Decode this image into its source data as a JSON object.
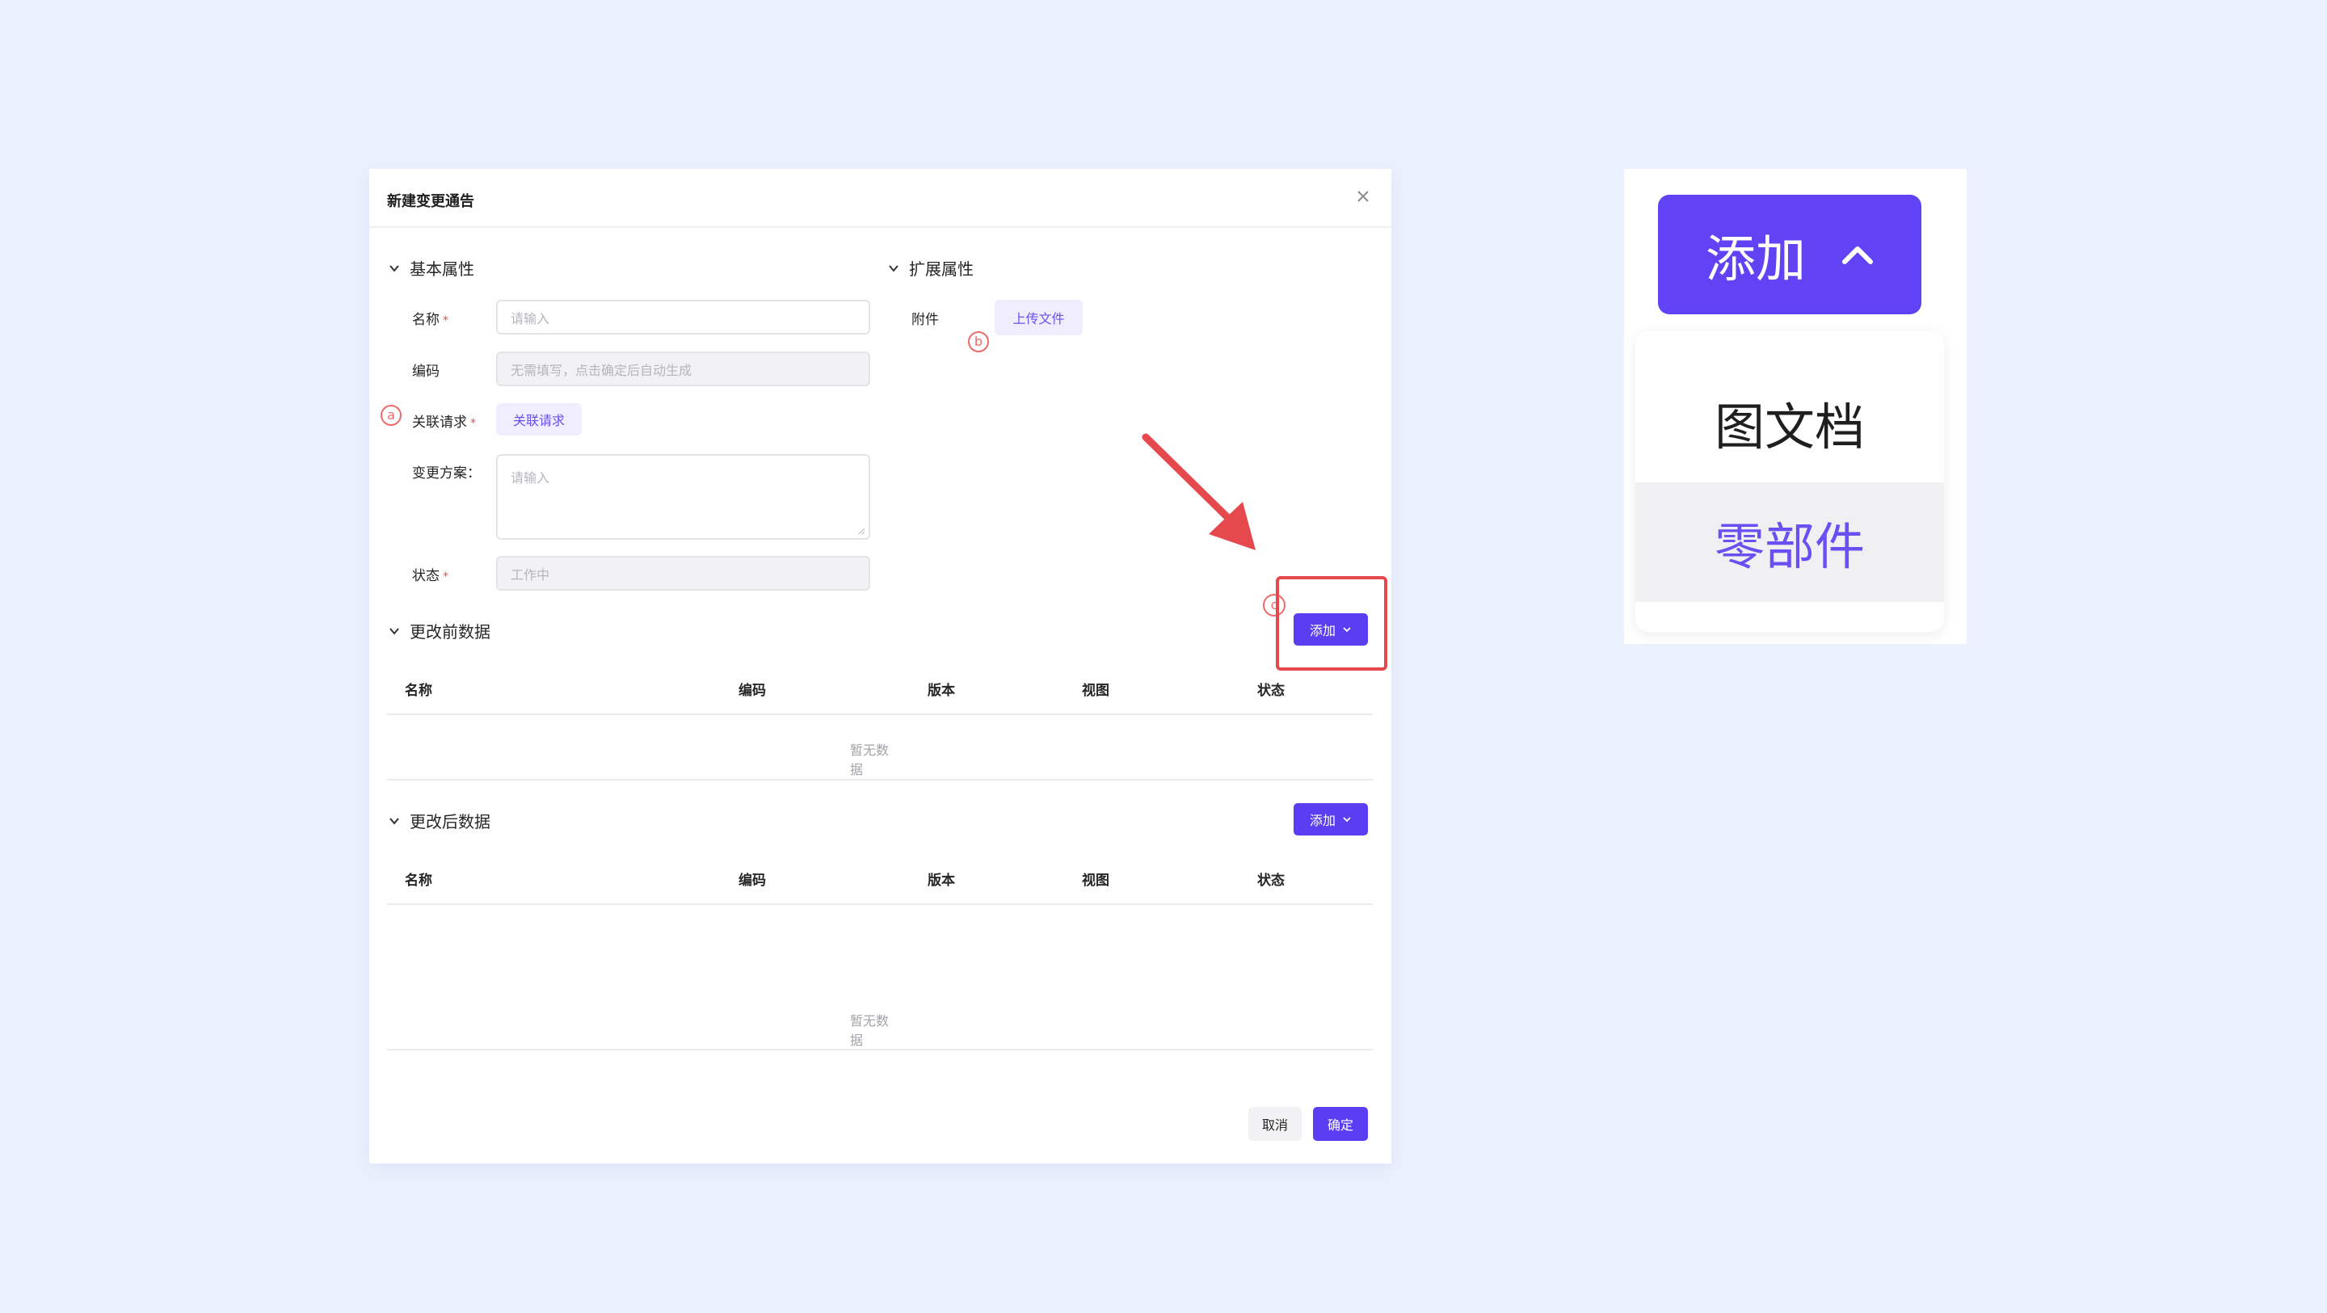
{
  "dialog": {
    "title": "新建变更通告",
    "basic_section": "基本属性",
    "ext_section": "扩展属性",
    "fields": {
      "name_label": "名称",
      "name_placeholder": "请输入",
      "code_label": "编码",
      "code_placeholder": "无需填写，点击确定后自动生成",
      "relreq_label": "关联请求",
      "relreq_button": "关联请求",
      "plan_label": "变更方案：",
      "plan_placeholder": "请输入",
      "status_label": "状态",
      "status_value": "工作中",
      "required_mark": "*"
    },
    "attachment": {
      "label": "附件",
      "upload_button": "上传文件"
    },
    "markers": {
      "a": "a",
      "b": "b",
      "c": "c"
    },
    "before_section": {
      "title": "更改前数据",
      "add_button": "添加",
      "columns": [
        "名称",
        "编码",
        "版本",
        "视图",
        "状态"
      ],
      "empty_text": "暂无数据"
    },
    "after_section": {
      "title": "更改后数据",
      "add_button": "添加",
      "columns": [
        "名称",
        "编码",
        "版本",
        "视图",
        "状态"
      ],
      "empty_text": "暂无数据"
    },
    "footer": {
      "cancel": "取消",
      "confirm": "确定"
    }
  },
  "zoom": {
    "add_button": "添加",
    "menu_items": [
      "图文档",
      "零部件"
    ]
  },
  "colors": {
    "primary": "#5b3ef2",
    "annotation_red": "#e5484d",
    "background": "#ebf1fe"
  }
}
